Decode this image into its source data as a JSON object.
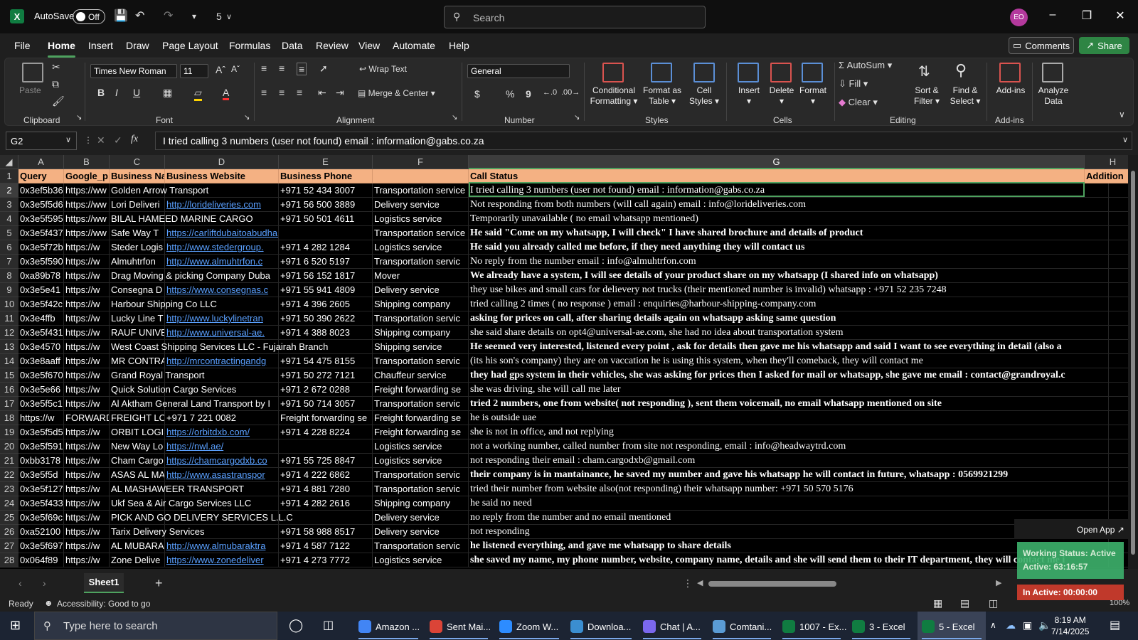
{
  "titlebar": {
    "autosave_label": "AutoSave",
    "autosave_state": "Off",
    "filename": "5",
    "search_placeholder": "Search",
    "avatar_initials": "EO"
  },
  "menu": {
    "tabs": [
      "File",
      "Home",
      "Insert",
      "Draw",
      "Page Layout",
      "Formulas",
      "Data",
      "Review",
      "View",
      "Automate",
      "Help"
    ],
    "active": "Home",
    "comments_label": "Comments",
    "share_label": "Share"
  },
  "ribbon": {
    "clipboard": {
      "paste": "Paste",
      "label": "Clipboard"
    },
    "font": {
      "family": "Times New Roman",
      "size": "11",
      "bold": "B",
      "italic": "I",
      "underline": "U",
      "label": "Font"
    },
    "alignment": {
      "wrap": "Wrap Text",
      "merge": "Merge & Center",
      "label": "Alignment"
    },
    "number": {
      "format": "General",
      "currency": "$",
      "percent": "%",
      "comma": "9",
      "label": "Number"
    },
    "styles": {
      "conditional_1": "Conditional",
      "conditional_2": "Formatting",
      "table_1": "Format as",
      "table_2": "Table",
      "cell_1": "Cell",
      "cell_2": "Styles",
      "label": "Styles"
    },
    "cells": {
      "insert": "Insert",
      "delete": "Delete",
      "format": "Format",
      "label": "Cells"
    },
    "editing": {
      "autosum": "AutoSum",
      "fill": "Fill",
      "clear": "Clear",
      "sort_1": "Sort &",
      "sort_2": "Filter",
      "find_1": "Find &",
      "find_2": "Select",
      "label": "Editing"
    },
    "addins": {
      "addins": "Add-ins",
      "label": "Add-ins"
    },
    "analyze": {
      "line1": "Analyze",
      "line2": "Data"
    }
  },
  "formula_bar": {
    "name_box": "G2",
    "fx": "fx",
    "content": "I tried calling 3 numbers (user not found) email : information@gabs.co.za"
  },
  "grid": {
    "columns": [
      "A",
      "B",
      "C",
      "D",
      "E",
      "F",
      "G",
      "H"
    ],
    "selected_column": "G",
    "selected_row": "2",
    "header": [
      "Query",
      "Google_p",
      "Business Na",
      "Business Website",
      "Business Phone",
      "",
      "Call Status",
      "Addition"
    ],
    "rows": [
      {
        "n": "2",
        "a": "0x3ef5b36",
        "b": "https://ww",
        "c": "Golden Arrow Transport",
        "d": "",
        "e": "+971 52 434 3007",
        "f": "Transportation service",
        "g": "I tried calling 3 numbers (user not found) email : information@gabs.co.za",
        "bold": false
      },
      {
        "n": "3",
        "a": "0x3e5f5d6",
        "b": "https://ww",
        "c": "Lori Deliveri",
        "d": "http://lorideliveries.com",
        "e": "+971 56 500 3889",
        "f": "Delivery service",
        "g": "Not responding from both numbers (will call again) email : info@lorideliveries.com",
        "bold": false
      },
      {
        "n": "4",
        "a": "0x3e5f595",
        "b": "https://ww",
        "c": "BILAL HAMEED MARINE CARGO",
        "d": "",
        "e": "+971 50 501 4611",
        "f": "Logistics service",
        "g": "Temporarily unavailable ( no email whatsapp mentioned)",
        "bold": false
      },
      {
        "n": "5",
        "a": "0x3e5f437",
        "b": "https://ww",
        "c": "Safe Way T",
        "d": "https://carliftdubaitoabudhabi.com/",
        "e": "",
        "f": "Transportation service",
        "g": "He said \"Come on my whatsapp, I will check\" I have shared brochure and details of product",
        "bold": true
      },
      {
        "n": "6",
        "a": "0x3e5f72b",
        "b": "https://w",
        "c": "Steder Logis",
        "d": "http://www.stedergroup.",
        "e": "+971 4 282 1284",
        "f": "Logistics service",
        "g": "He said you already called me before, if they need anything they will contact us",
        "bold": true
      },
      {
        "n": "7",
        "a": "0x3e5f590",
        "b": "https://w",
        "c": "Almuhtrfon",
        "d": "http://www.almuhtrfon.c",
        "e": "+971 6 520 5197",
        "f": "Transportation servic",
        "g": "No reply from the number  email : info@almuhtrfon.com",
        "bold": false
      },
      {
        "n": "8",
        "a": "0xa89b78",
        "b": "https://w",
        "c": "Drag Moving & picking Company Duba",
        "d": "",
        "e": "+971 56 152 1817",
        "f": "Mover",
        "g": "We already have a system, I will see details of your product share on my whatsapp (I shared info on whatsapp)",
        "bold": true
      },
      {
        "n": "9",
        "a": "0x3e5e41",
        "b": "https://w",
        "c": "Consegna D",
        "d": "https://www.consegnas.c",
        "e": "+971 55 941 4809",
        "f": "Delivery service",
        "g": "they use bikes and small cars for delievery not trucks (their mentioned number is invalid) whatsapp : +971 52 235 7248",
        "bold": false
      },
      {
        "n": "10",
        "a": "0x3e5f42c",
        "b": "https://w",
        "c": "Harbour Shipping Co LLC",
        "d": "",
        "e": "+971 4 396 2605",
        "f": "Shipping company",
        "g": "tried calling 2 times ( no response ) email : enquiries@harbour-shipping-company.com",
        "bold": false
      },
      {
        "n": "11",
        "a": "0x3e4ffb",
        "b": "https://w",
        "c": "Lucky Line T",
        "d": "http://www.luckylinetran",
        "e": "+971 50 390 2622",
        "f": "Transportation servic",
        "g": "asking for prices on call, after sharing details again on whatsapp asking same question",
        "bold": true
      },
      {
        "n": "12",
        "a": "0x3e5f431",
        "b": "https://w",
        "c": "RAUF UNIVE",
        "d": "http://www.universal-ae.",
        "e": "+971 4 388 8023",
        "f": "Shipping company",
        "g": "she said share details on opt4@universal-ae.com, she had no idea about transportation system",
        "bold": false
      },
      {
        "n": "13",
        "a": "0x3e4570",
        "b": "https://w",
        "c": "West Coast Shipping Services LLC - Fujairah Branch",
        "d": "",
        "e": "",
        "f": "Shipping service",
        "g": "He seemed very interested, listened every point , ask for details then gave me his whatsapp and said I want to see everything in detail (also a",
        "bold": true
      },
      {
        "n": "14",
        "a": "0x3e8aaff",
        "b": "https://w",
        "c": "MR CONTRA",
        "d": "http://mrcontractingandg",
        "e": "+971 54 475 8155",
        "f": "Transportation servic",
        "g": "(its his son's company) they are on vaccation he is using this system, when they'll comeback, they will contact me",
        "bold": false
      },
      {
        "n": "15",
        "a": "0x3e5f670",
        "b": "https://w",
        "c": "Grand Royal Transport",
        "d": "",
        "e": "+971 50 272 7121",
        "f": "Chauffeur service",
        "g": "they had gps system in their vehicles, she was asking for prices then I asked for mail or whatsapp, she gave me email : contact@grandroyal.c",
        "bold": true
      },
      {
        "n": "16",
        "a": "0x3e5e66",
        "b": "https://w",
        "c": "Quick Solution Cargo Services",
        "d": "",
        "e": "+971 2 672 0288",
        "f": "Freight forwarding se",
        "g": "she was driving, she will call me later",
        "bold": false
      },
      {
        "n": "17",
        "a": "0x3e5f5c1",
        "b": "https://w",
        "c": "Al Aktham General Land Transport by I",
        "d": "",
        "e": "+971 50 714 3057",
        "f": "Transportation servic",
        "g": "tried 2 numbers, one from website( not responding ), sent them voicemail, no email whatsapp mentioned on site",
        "bold": true
      },
      {
        "n": "18",
        "a": "https://w",
        "b": "FORWARD",
        "c": "FREIGHT LO",
        "d": "+971 7 221 0082",
        "e": "Freight forwarding se",
        "f": "Freight forwarding se",
        "g": "he is outside uae",
        "bold": false
      },
      {
        "n": "19",
        "a": "0x3e5f5d5",
        "b": "https://w",
        "c": "ORBIT LOGIS",
        "d": "https://orbitdxb.com/",
        "e": "+971 4 228 8224",
        "f": "Freight forwarding se",
        "g": "she is not in office, and not replying",
        "bold": false
      },
      {
        "n": "20",
        "a": "0x3e5f591",
        "b": "https://w",
        "c": "New Way Lo",
        "d": "https://nwl.ae/",
        "e": "",
        "f": "Logistics service",
        "g": "not a working number, called number from site not responding, email : info@headwaytrd.com",
        "bold": false
      },
      {
        "n": "21",
        "a": "0xbb3178",
        "b": "https://w",
        "c": "Cham Cargo",
        "d": "https://chamcargodxb.co",
        "e": "+971 55 725 8847",
        "f": "Logistics service",
        "g": "not responding their email : cham.cargodxb@gmail.com",
        "bold": false
      },
      {
        "n": "22",
        "a": "0x3e5f5d",
        "b": "https://w",
        "c": "ASAS AL MA",
        "d": "http://www.asastranspor",
        "e": "+971 4 222 6862",
        "f": "Transportation servic",
        "g": "their company is in mantainance, he saved my number and gave his whatsapp he will contact in future, whatsapp : 0569921299",
        "bold": true
      },
      {
        "n": "23",
        "a": "0x3e5f127",
        "b": "https://w",
        "c": "AL MASHAWEER TRANSPORT",
        "d": "",
        "e": "+971 4 881 7280",
        "f": "Transportation servic",
        "g": "tried their number from website also(not responding) their whatsapp number: +971 50 570 5176",
        "bold": false
      },
      {
        "n": "24",
        "a": "0x3e5f433",
        "b": "https://w",
        "c": "Ukf Sea & Air Cargo Services LLC",
        "d": "",
        "e": "+971 4 282 2616",
        "f": "Shipping company",
        "g": "he said no need",
        "bold": false
      },
      {
        "n": "25",
        "a": "0x3e5f69c",
        "b": "https://w",
        "c": "PICK AND GO DELIVERY SERVICES L.L.C",
        "d": "",
        "e": "",
        "f": "Delivery service",
        "g": "no reply from the number and no email mentioned",
        "bold": false
      },
      {
        "n": "26",
        "a": "0xa52100",
        "b": "https://w",
        "c": "Tarix Delivery Services",
        "d": "",
        "e": "+971 58 988 8517",
        "f": "Delivery service",
        "g": "not responding",
        "bold": false
      },
      {
        "n": "27",
        "a": "0x3e5f697",
        "b": "https://w",
        "c": "AL MUBARA",
        "d": "http://www.almubaraktra",
        "e": "+971 4 587 7122",
        "f": "Transportation servic",
        "g": "he listened everything, and gave me whatsapp to share details",
        "bold": true
      },
      {
        "n": "28",
        "a": "0x064f89",
        "b": "https://w",
        "c": "Zone Delive",
        "d": "https://www.zonedeliver",
        "e": "+971 4 273 7772",
        "f": "Logistics service",
        "g": "she saved my name, my phone number, website, company name, details and she will send them to their IT department, they will contact me i",
        "bold": true
      }
    ]
  },
  "overlay": {
    "open_app": "Open App ↗",
    "working_status": "Working Status: Active",
    "active_time": "Active: 63:16:57",
    "inactive_time": "In Active: 00:00:00"
  },
  "sheets": {
    "active": "Sheet1",
    "add": "+"
  },
  "statusbar": {
    "ready": "Ready",
    "accessibility": "Accessibility: Good to go",
    "zoom": "100%"
  },
  "taskbar": {
    "search_placeholder": "Type here to search",
    "apps": [
      {
        "label": "Amazon ...",
        "color": "#4285f4"
      },
      {
        "label": "Sent Mai...",
        "color": "#db4437"
      },
      {
        "label": "Zoom W...",
        "color": "#2d8cff"
      },
      {
        "label": "Downloa...",
        "color": "#3b8ed0"
      },
      {
        "label": "Chat | A...",
        "color": "#7b68ee"
      },
      {
        "label": "Comtani...",
        "color": "#5a9bd4"
      },
      {
        "label": "1007 - Ex...",
        "color": "#107c41"
      },
      {
        "label": "3 - Excel",
        "color": "#107c41"
      },
      {
        "label": "5 - Excel",
        "color": "#107c41"
      }
    ],
    "time": "8:19 AM",
    "date": "7/14/2025"
  }
}
